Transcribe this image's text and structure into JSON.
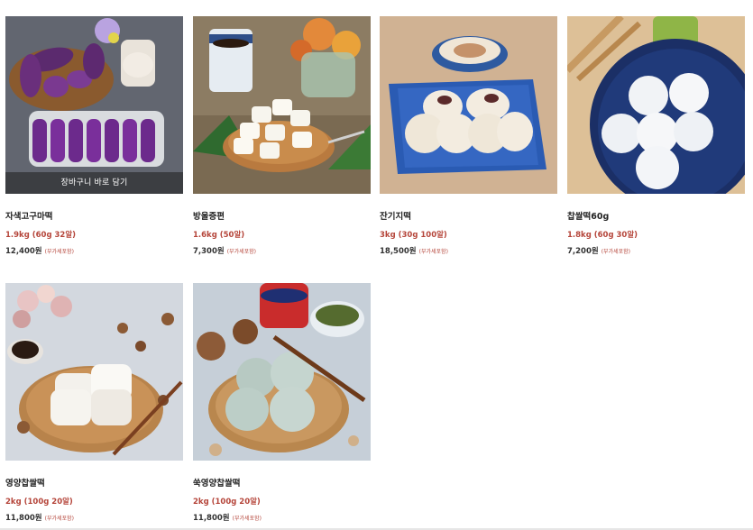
{
  "products": [
    {
      "name": "자색고구마떡",
      "option": "1.9kg (60g 32알)",
      "price": "12,400원",
      "vat": "(부가세포함)",
      "cart_label": "장바구니 바로 담기"
    },
    {
      "name": "방울증편",
      "option": "1.6kg (50알)",
      "price": "7,300원",
      "vat": "(부가세포함)"
    },
    {
      "name": "잔기지떡",
      "option": "3kg (30g 100알)",
      "price": "18,500원",
      "vat": "(부가세포함)"
    },
    {
      "name": "찹쌀떡60g",
      "option": "1.8kg (60g 30알)",
      "price": "7,200원",
      "vat": "(부가세포함)"
    },
    {
      "name": "영양찹쌀떡",
      "option": "2kg (100g 20알)",
      "price": "11,800원",
      "vat": "(부가세포함)"
    },
    {
      "name": "쑥영양찹쌀떡",
      "option": "2kg (100g 20알)",
      "price": "11,800원",
      "vat": "(부가세포함)"
    }
  ],
  "colors": {
    "option_text": "#b5453a",
    "name_text": "#222222"
  }
}
